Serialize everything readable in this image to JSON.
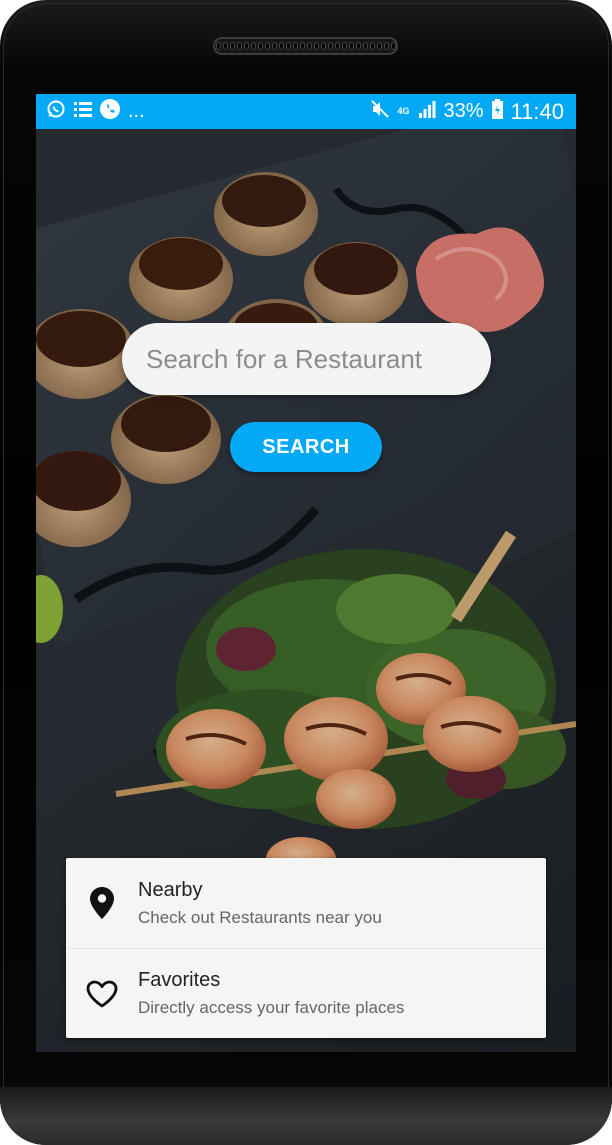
{
  "status_bar": {
    "notification_icons": [
      "whatsapp-icon",
      "list-icon",
      "phone-icon"
    ],
    "more_indicator": "...",
    "network_label": "4G",
    "battery_percent": "33%",
    "time": "11:40",
    "bar_color": "#03a9f4"
  },
  "search": {
    "placeholder": "Search for a Restaurant",
    "value": "",
    "button_label": "SEARCH"
  },
  "menu": {
    "items": [
      {
        "icon": "location-pin-icon",
        "title": "Nearby",
        "subtitle": "Check out Restaurants near you"
      },
      {
        "icon": "heart-outline-icon",
        "title": "Favorites",
        "subtitle": "Directly access your favorite places"
      }
    ]
  },
  "background": {
    "subject": "sushi-and-shrimp-skewer-photo"
  },
  "colors": {
    "accent": "#03a9f4",
    "card": "#f5f5f5",
    "text_primary": "#222222",
    "text_secondary": "#666666"
  }
}
